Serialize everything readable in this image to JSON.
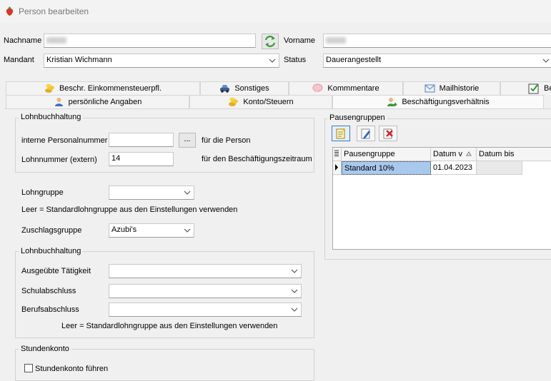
{
  "window": {
    "title": "Person bearbeiten"
  },
  "header": {
    "nachname_label": "Nachname",
    "vorname_label": "Vorname",
    "mandant_label": "Mandant",
    "mandant_value": "Kristian Wichmann",
    "status_label": "Status",
    "status_value": "Dauerangestellt"
  },
  "tabs_row1": [
    {
      "label": "Beschr. Einkommensteuerpfl.",
      "icon": "coins-icon"
    },
    {
      "label": "Sonstiges",
      "icon": "car-icon"
    },
    {
      "label": "Kommmentare",
      "icon": "comment-icon"
    },
    {
      "label": "Mailhistorie",
      "icon": "mail-icon"
    },
    {
      "label": "Be",
      "icon": "checklist-icon"
    }
  ],
  "tabs_row2": [
    {
      "label": "persönliche Angaben",
      "icon": "person-icon"
    },
    {
      "label": "Konto/Steuern",
      "icon": "coins-icon"
    },
    {
      "label": "Beschäftigungsverhältnis",
      "icon": "person-add-icon"
    }
  ],
  "lohnbuchhaltung1": {
    "title": "Lohnbuchhaltung",
    "personalnummer_label": "interne Personalnummer",
    "personalnummer_value": "",
    "browse_label": "...",
    "fuer_person": "für die Person",
    "lohnnummer_label": "Lohnnummer (extern)",
    "lohnnummer_value": "14",
    "fuer_zeitraum": "für den Beschäftigungszeitraum"
  },
  "lohngruppe": {
    "label": "Lohngruppe",
    "value": "",
    "hint": "Leer = Standardlohngruppe aus den Einstellungen verwenden"
  },
  "zuschlagsgruppe": {
    "label": "Zuschlagsgruppe",
    "value": "Azubi's"
  },
  "lohnbuchhaltung2": {
    "title": "Lohnbuchhaltung",
    "taetigkeit_label": "Ausgeübte Tätigkeit",
    "taetigkeit_value": "",
    "schulabschluss_label": "Schulabschluss",
    "schulabschluss_value": "",
    "berufsabschluss_label": "Berufsabschluss",
    "berufsabschluss_value": "",
    "hint": "Leer = Standardlohngruppe aus den Einstellungen verwenden"
  },
  "stundenkonto": {
    "title": "Stundenkonto",
    "checkbox_label": "Stundenkonto führen",
    "checked": false
  },
  "pausengruppen": {
    "title": "Pausengruppen",
    "toolbar": [
      "add-icon",
      "edit-icon",
      "delete-icon"
    ],
    "columns": [
      "Pausengruppe",
      "Datum v",
      "Datum bis"
    ],
    "rows": [
      {
        "pausengruppe": "Standard 10%",
        "datum_von": "01.04.2023",
        "datum_bis": ""
      }
    ]
  },
  "colors": {
    "selection": "#a9c8ee",
    "accent": "#3a78c8"
  }
}
